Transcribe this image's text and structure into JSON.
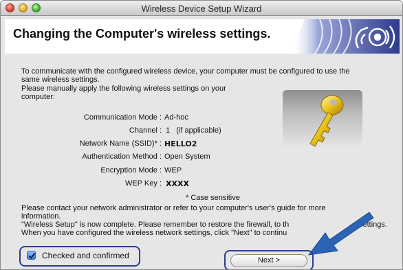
{
  "window": {
    "title": "Wireless Device Setup Wizard"
  },
  "header": {
    "heading": "Changing the Computer's wireless settings."
  },
  "intro": {
    "line1": "To communicate with the configured wireless device, your computer must be configured to use the",
    "line2": "same wireless settings.",
    "line3": "Please manually apply the following wireless settings on your",
    "line4": "computer:"
  },
  "settings": [
    {
      "label": "Communication Mode :",
      "value": "Ad-hoc"
    },
    {
      "label": "Channel :",
      "value": "1   (if applicable)"
    },
    {
      "label": "Network Name (SSID)* :",
      "value": "HELLO2"
    },
    {
      "label": "Authentication Method :",
      "value": "Open System"
    },
    {
      "label": "Encryption Mode :",
      "value": "WEP"
    },
    {
      "label": "WEP Key :",
      "value": "XXXX"
    }
  ],
  "note": "* Case sensitive",
  "footer": {
    "line1": "Please contact your network administrator or refer to your computer's user's guide for more",
    "line2": "information.",
    "line3": "\"Wireless Setup\" is now complete. Please remember to restore the firewall, to th",
    "line3b": "settings.",
    "line4": "When you have configured the wireless network settings, click \"Next\" to continu"
  },
  "checkbox": {
    "label": "Checked and confirmed",
    "checked": true
  },
  "next_button": {
    "label": "Next >"
  },
  "colors": {
    "accent": "#2f3d8f",
    "arrow": "#2b63b6"
  }
}
